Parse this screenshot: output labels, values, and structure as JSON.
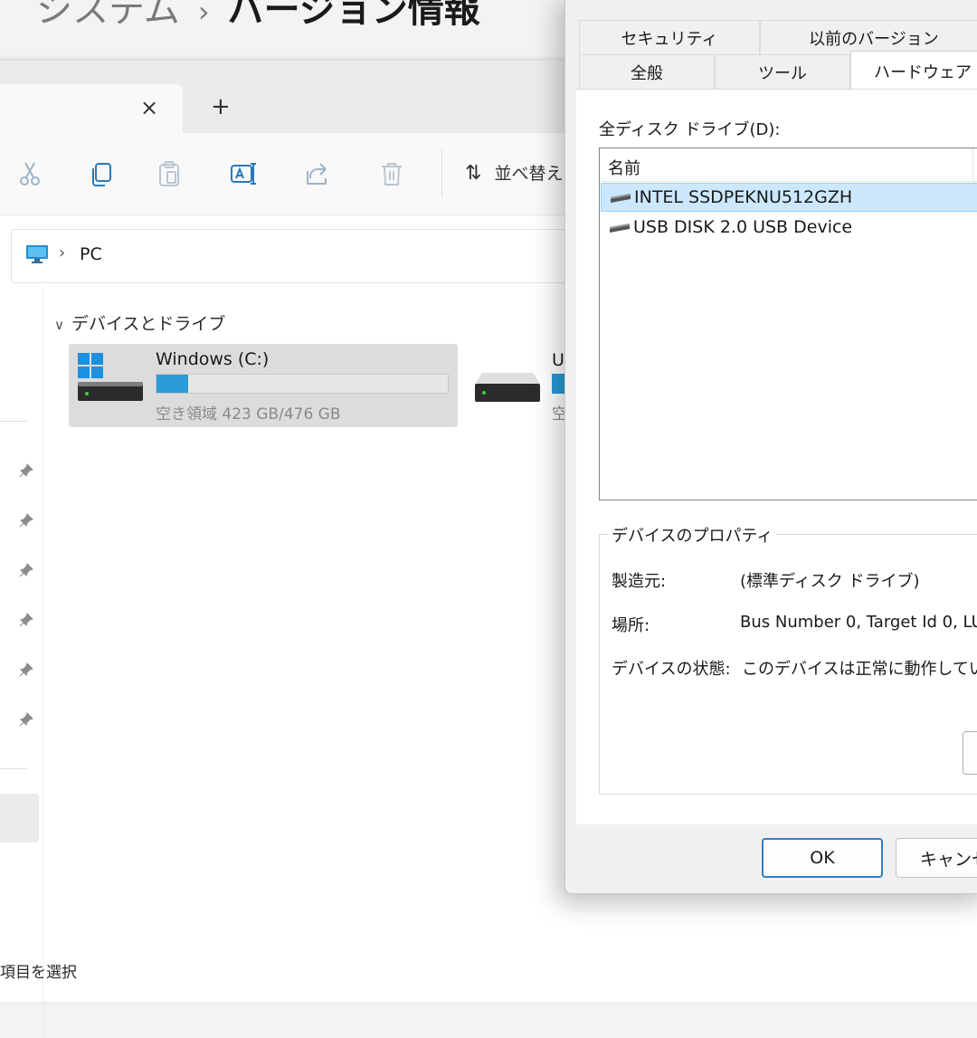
{
  "background": {
    "title_parent": "システム",
    "title_separator": "›",
    "title_current": "バージョン情報"
  },
  "explorer": {
    "tab_close": "×",
    "tab_add": "+",
    "toolbar": {
      "icons": [
        "cut-icon",
        "copy-icon",
        "paste-icon",
        "rename-icon",
        "share-icon",
        "delete-icon"
      ],
      "sort_label": "並べ替え"
    },
    "address": {
      "chevron": "›",
      "location": "PC"
    },
    "section_title": "デバイスとドライブ",
    "drives": [
      {
        "name": "Windows (C:)",
        "free_text": "空き領域 423 GB/476 GB",
        "used_fraction": 0.11
      },
      {
        "name": "U",
        "free_text": "空"
      }
    ],
    "status_text": "項目を選択",
    "pinned_count": 6
  },
  "dialog": {
    "tabs_row1": [
      "セキュリティ",
      "以前のバージョン"
    ],
    "tabs_row2": [
      "全般",
      "ツール",
      "ハードウェア"
    ],
    "active_tab": "ハードウェア",
    "disk_label": "全ディスク ドライブ(D):",
    "list_header": "名前",
    "disks": [
      {
        "name": "INTEL SSDPEKNU512GZH",
        "selected": true
      },
      {
        "name": "USB DISK 2.0 USB Device",
        "selected": false
      }
    ],
    "device_properties": {
      "legend": "デバイスのプロパティ",
      "manufacturer_label": "製造元:",
      "manufacturer_value": "(標準ディスク ドライブ)",
      "location_label": "場所:",
      "location_value": "Bus Number 0, Target Id 0, LU",
      "status_label": "デバイスの状態:",
      "status_value": "このデバイスは正常に動作してい"
    },
    "ok_label": "OK",
    "cancel_label": "キャンセ"
  },
  "colors": {
    "accent": "#2a9ad8",
    "selection": "#cce8ff"
  }
}
